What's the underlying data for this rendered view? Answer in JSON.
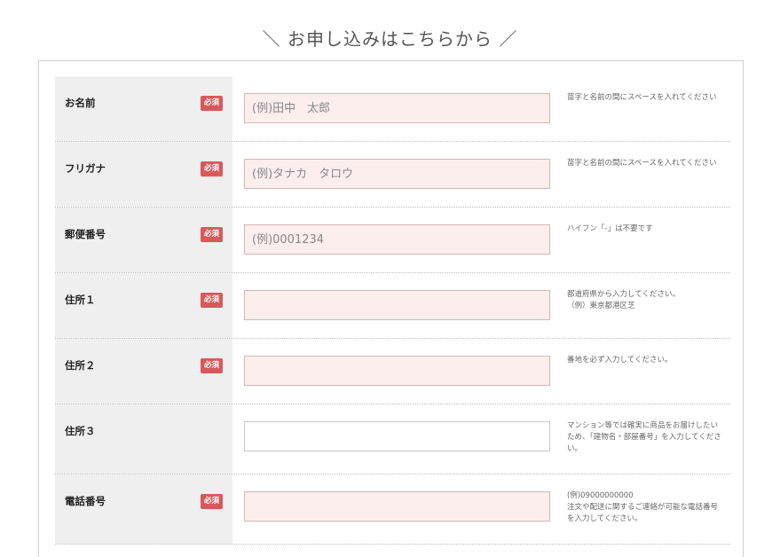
{
  "heading": "＼ お申し込みはこちらから ／",
  "required_label": "必須",
  "fields": [
    {
      "label": "お名前",
      "required": true,
      "placeholder": "(例)田中　太郎",
      "value": "",
      "note": "苗字と名前の間にスペースを入れてください"
    },
    {
      "label": "フリガナ",
      "required": true,
      "placeholder": "(例)タナカ　タロウ",
      "value": "",
      "note": "苗字と名前の間にスペースを入れてください"
    },
    {
      "label": "郵便番号",
      "required": true,
      "placeholder": "(例)0001234",
      "value": "",
      "note": "ハイフン「-」は不要です"
    },
    {
      "label": "住所１",
      "required": true,
      "placeholder": "",
      "value": "",
      "note": "都道府県から入力してください。\n（例）東京都港区芝"
    },
    {
      "label": "住所２",
      "required": true,
      "placeholder": "",
      "value": "",
      "note": "番地を必ず入力してください。"
    },
    {
      "label": "住所３",
      "required": false,
      "placeholder": "",
      "value": "",
      "note": "マンション等では確実に商品をお届けしたいため、「建物名・部屋番号」を入力してください。"
    },
    {
      "label": "電話番号",
      "required": true,
      "placeholder": "",
      "value": "",
      "note": "(例)09000000000\n注文や配送に関するご連絡が可能な電話番号を入力してください。"
    }
  ],
  "colors": {
    "required_badge": "#d9595b",
    "input_background": "#fdeeee",
    "label_background": "#efefef"
  }
}
